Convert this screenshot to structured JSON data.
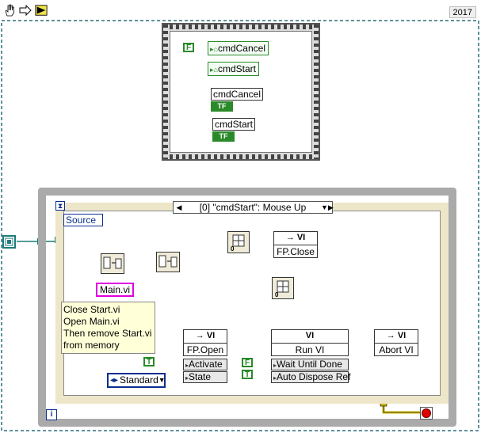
{
  "toolbar": {
    "version": "2017",
    "icons": [
      "hand-icon",
      "right-arrow-icon",
      "run-vi-icon"
    ]
  },
  "flat_sequence": {
    "false_constant": "F",
    "local_vars": [
      "cmdCancel",
      "cmdStart"
    ],
    "controls": [
      {
        "label": "cmdCancel",
        "terminal": "TF"
      },
      {
        "label": "cmdStart",
        "terminal": "TF"
      }
    ]
  },
  "event_structure": {
    "case_label": "[0] \"cmdStart\": Mouse Up",
    "event_data": "Source",
    "iteration": "i"
  },
  "nodes": {
    "string_constant": "Main.vi",
    "comment_lines": [
      "Close Start.vi",
      "Open Main.vi",
      "Then remove Start.vi",
      "from memory"
    ],
    "fp_close": {
      "header": "→ VI",
      "label": "FP.Close"
    },
    "fp_open": {
      "header": "→ VI",
      "label": "FP.Open",
      "props": [
        "Activate",
        "State"
      ]
    },
    "run_vi": {
      "header": "VI",
      "label": "Run VI",
      "props": [
        "Wait Until Done",
        "Auto Dispose Ref"
      ]
    },
    "abort_vi": {
      "header": "→ VI",
      "label": "Abort VI"
    },
    "enum_value": "Standard",
    "true_constant": "T",
    "false_constant": "F"
  },
  "colors": {
    "boolean": "#2a8a2a",
    "refnum": "#1e7b7b",
    "error_cluster": "#c8b400",
    "string": "#e000e0",
    "enum": "#0a2f8f"
  }
}
